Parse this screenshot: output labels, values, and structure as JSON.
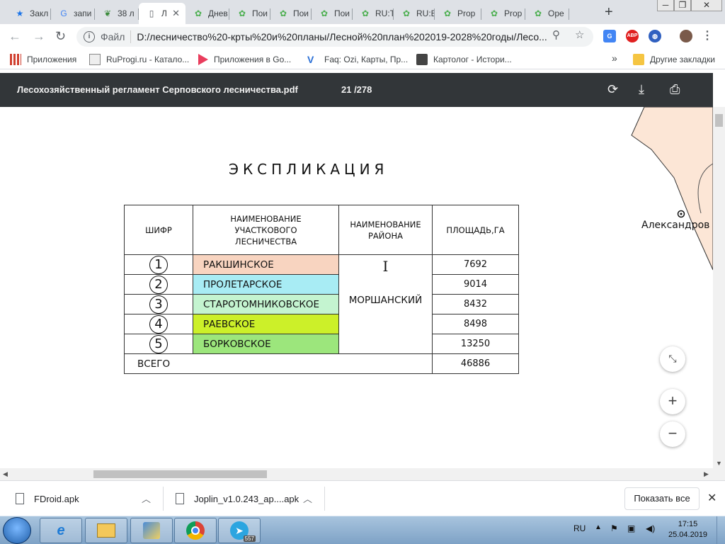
{
  "tabs": [
    {
      "label": "Закл",
      "icon": "star-icon"
    },
    {
      "label": "запи",
      "icon": "google-icon"
    },
    {
      "label": "38 л",
      "icon": "green-leaf-icon"
    },
    {
      "label": "Л",
      "icon": "document-icon",
      "active": true
    },
    {
      "label": "Днев",
      "icon": "leaf-icon"
    },
    {
      "label": "Пои",
      "icon": "leaf-icon"
    },
    {
      "label": "Пои",
      "icon": "leaf-icon"
    },
    {
      "label": "Пои",
      "icon": "leaf-icon"
    },
    {
      "label": "RU:Т",
      "icon": "leaf-icon"
    },
    {
      "label": "RU:В",
      "icon": "leaf-icon"
    },
    {
      "label": "Prop",
      "icon": "leaf-icon"
    },
    {
      "label": "Prop",
      "icon": "leaf-icon"
    },
    {
      "label": "Ope",
      "icon": "leaf-icon"
    }
  ],
  "address": {
    "scheme": "Файл",
    "url": "D:/лесничество%20-крты%20и%20планы/Лесной%20план%202019-2028%20годы/Лесо..."
  },
  "extensions": [
    "translate-icon",
    "adblock-icon",
    "vpn-icon"
  ],
  "extension_labels": {
    "adblock": "ABP"
  },
  "bookmarks": [
    {
      "label": "Приложения",
      "icon": "apps-grid-icon"
    },
    {
      "label": "RuProgi.ru - Катало...",
      "icon": "ruprogi-icon"
    },
    {
      "label": "Приложения в Go...",
      "icon": "google-play-icon"
    },
    {
      "label": "Faq: Ozi, Карты, Пр...",
      "icon": "ozi-icon"
    },
    {
      "label": "Картолог - Истори...",
      "icon": "kartolog-icon"
    }
  ],
  "bookmarks_overflow": "»",
  "other_bookmarks": "Другие закладки",
  "pdf": {
    "title": "Лесохозяйственный регламент Серповского лесничества.pdf",
    "page": "21 /278"
  },
  "document": {
    "heading": "ЭКСПЛИКАЦИЯ",
    "headers": [
      "ШИФР",
      "НАИМЕНОВАНИЕ УЧАСТКОВОГО ЛЕСНИЧЕСТВА",
      "НАИМЕНОВАНИЕ РАЙОНА",
      "ПЛОЩАДЬ,ГА"
    ],
    "rows": [
      {
        "code": "1",
        "name": "РАКШИНСКОЕ",
        "area": "7692",
        "color": "#f8d4c0"
      },
      {
        "code": "2",
        "name": "ПРОЛЕТАРСКОЕ",
        "area": "9014",
        "color": "#a8ecf4"
      },
      {
        "code": "3",
        "name": "СТАРОТОМНИКОВСКОЕ",
        "area": "8432",
        "color": "#c4f4d0"
      },
      {
        "code": "4",
        "name": "РАЕВСКОЕ",
        "area": "8498",
        "color": "#ccf029"
      },
      {
        "code": "5",
        "name": "БОРКОВСКОЕ",
        "area": "13250",
        "color": "#9ce67c"
      }
    ],
    "district_roman": "I",
    "district": "МОРШАНСКИЙ",
    "total_label": "ВСЕГО",
    "total_area": "46886",
    "map_label": "Александров"
  },
  "downloads": [
    {
      "label": "FDroid.apk"
    },
    {
      "label": "Joplin_v1.0.243_ap....apk"
    }
  ],
  "show_all": "Показать все",
  "taskbar": {
    "lang": "RU",
    "time": "17:15",
    "date": "25.04.2019",
    "telegram_badge": "557"
  }
}
